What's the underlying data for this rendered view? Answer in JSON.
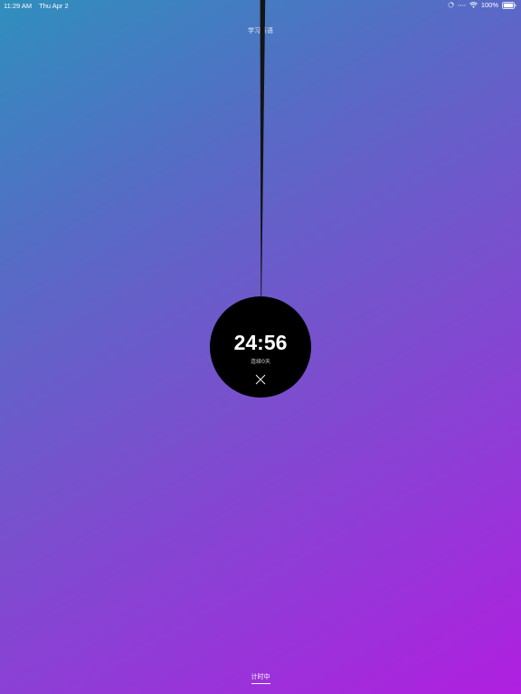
{
  "status_bar": {
    "time": "11:29 AM",
    "date": "Thu Apr 2",
    "battery_percent": "100%",
    "icons": [
      "loading-icon",
      "signal-dots-icon",
      "wifi-icon",
      "battery-icon"
    ]
  },
  "header": {
    "title": "学习英语"
  },
  "timer": {
    "time": "24:56",
    "streak": "连续0天",
    "close_icon": "close-icon"
  },
  "footer": {
    "status_label": "计时中"
  },
  "colors": {
    "gradient_start": "#2f8fbd",
    "gradient_end": "#b01fe0",
    "disc": "#000000",
    "text": "#ffffff"
  }
}
